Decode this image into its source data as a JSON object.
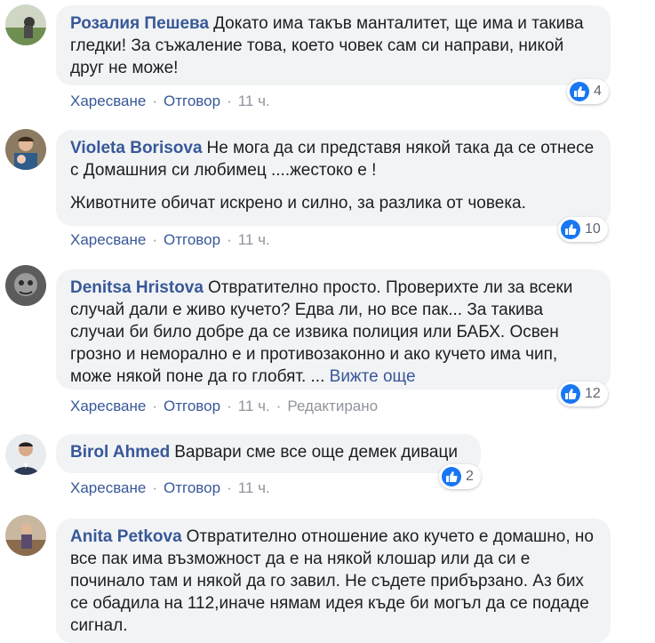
{
  "comments": [
    {
      "author": "Розалия Пешева",
      "text": "Докато има такъв манталитет, ще има и такива гледки! За съжаление това, което човек сам си направи, никой друг не може!",
      "like": "Харесване",
      "reply": "Отговор",
      "time": "11 ч.",
      "reactions": "4"
    },
    {
      "author": "Violeta Borisova",
      "text": "Не мога да си представя някой така да се отнесе с Домашния си любимец ....жестоко е !",
      "text2": "Животните обичат искрено и силно, за разлика от човека.",
      "like": "Харесване",
      "reply": "Отговор",
      "time": "11 ч.",
      "reactions": "10"
    },
    {
      "author": "Denitsa Hristova",
      "text": "Отвратително просто. Проверихте ли за всеки случай дали е живо кучето? Едва ли, но все пак... За такива случаи би било добре да се извика полиция или БАБХ. Освен грозно и неморално е и противозаконно и ако кучето има чип, може някой поне да го глобят. ...",
      "see_more": "Вижте още",
      "like": "Харесване",
      "reply": "Отговор",
      "time": "11 ч.",
      "edited": "Редактирано",
      "reactions": "12"
    },
    {
      "author": "Birol Ahmed",
      "text": "Варвари сме все още демек диваци",
      "like": "Харесване",
      "reply": "Отговор",
      "time": "11 ч.",
      "reactions": "2"
    },
    {
      "author": "Anita Petkova",
      "text": "Отвратително отношение ако кучето е домашно, но все пак има възможност да е на някой клошар или да си е починало там и някой да го завил. Не съдете прибързано. Аз бих се обадила на 112,иначе нямам идея къде би могъл да се подаде сигнал."
    }
  ],
  "colors": {
    "link": "#385898",
    "bubble": "#f2f3f5",
    "like_badge": "#1877f2",
    "meta": "#90949c"
  },
  "icons": {
    "reaction": "like-thumb-icon"
  }
}
